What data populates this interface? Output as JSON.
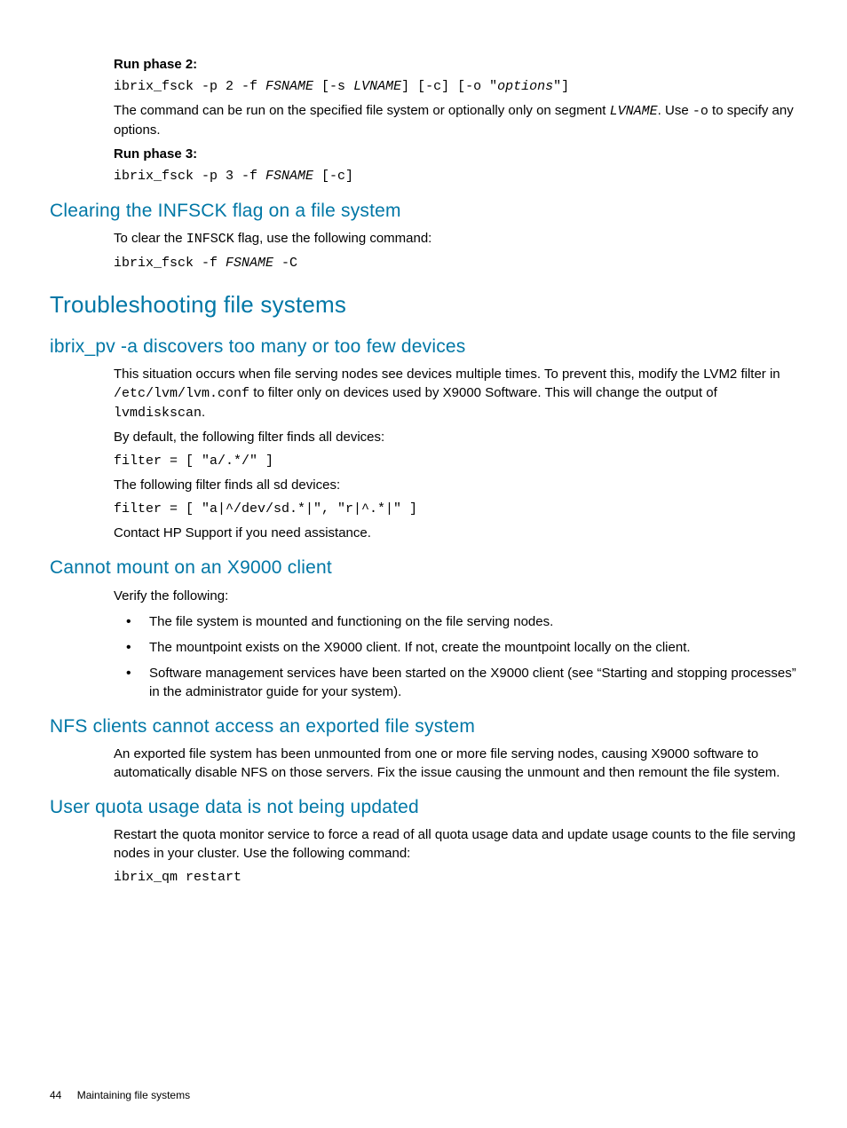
{
  "sec_phase2": {
    "label": "Run phase 2:",
    "cmd_a": "ibrix_fsck -p 2 -f ",
    "cmd_b": "FSNAME",
    "cmd_c": " [-s ",
    "cmd_d": "LVNAME",
    "cmd_e": "] [-c] [-o \"",
    "cmd_f": "options",
    "cmd_g": "\"]",
    "desc_a": "The command can be run on the specified file system or optionally only on segment ",
    "desc_b": "LVNAME",
    "desc_c": ". Use ",
    "desc_d": "-o",
    "desc_e": " to specify any options."
  },
  "sec_phase3": {
    "label": "Run phase 3:",
    "cmd_a": "ibrix_fsck -p 3 -f ",
    "cmd_b": "FSNAME",
    "cmd_c": " [-c]"
  },
  "clearing": {
    "title": "Clearing the INFSCK flag on a file system",
    "desc_a": "To clear the ",
    "desc_b": "INFSCK",
    "desc_c": " flag, use the following command:",
    "cmd_a": "ibrix_fsck -f ",
    "cmd_b": "FSNAME",
    "cmd_c": " -C"
  },
  "troubleshoot": {
    "title": "Troubleshooting file systems"
  },
  "ibrix_pv": {
    "title": "ibrix_pv -a discovers too many or too few devices",
    "p1_a": "This situation occurs when file serving nodes see devices multiple times. To prevent this, modify the LVM2 filter in ",
    "p1_b": "/etc/lvm/lvm.conf",
    "p1_c": " to filter only on devices used by X9000 Software. This will change the output of ",
    "p1_d": "lvmdiskscan",
    "p1_e": ".",
    "p2": "By default, the following filter finds all devices:",
    "filter1": "filter = [ \"a/.*/\" ]",
    "p3": "The following filter finds all sd devices:",
    "filter2": "filter = [ \"a|^/dev/sd.*|\", \"r|^.*|\" ]",
    "p4": "Contact HP Support if you need assistance."
  },
  "cannot_mount": {
    "title": "Cannot mount on an X9000 client",
    "intro": "Verify the following:",
    "b1": "The file system is mounted and functioning on the file serving nodes.",
    "b2": "The mountpoint exists on the X9000 client. If not, create the mountpoint locally on the client.",
    "b3": "Software management services have been started on the X9000 client (see “Starting and stopping processes” in the administrator guide for your system)."
  },
  "nfs": {
    "title": "NFS clients cannot access an exported file system",
    "p1": "An exported file system has been unmounted from one or more file serving nodes, causing X9000 software to automatically disable NFS on those servers. Fix the issue causing the unmount and then remount the file system."
  },
  "quota": {
    "title": "User quota usage data is not being updated",
    "p1": "Restart the quota monitor service to force a read of all quota usage data and update usage counts to the file serving nodes in your cluster. Use the following command:",
    "cmd": "ibrix_qm restart"
  },
  "footer": {
    "page": "44",
    "chapter": "Maintaining file systems"
  }
}
